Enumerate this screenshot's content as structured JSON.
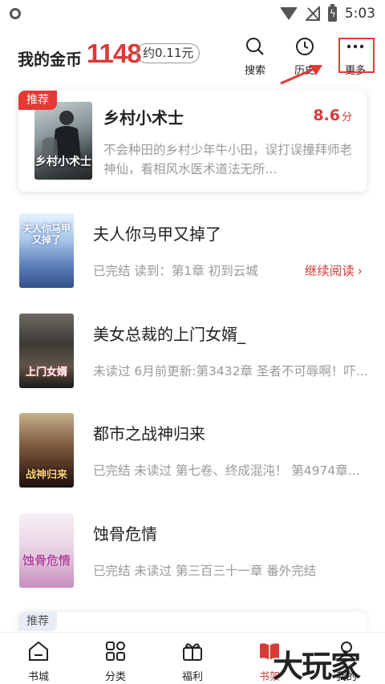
{
  "status_bar": {
    "time": "5:03"
  },
  "header": {
    "coin_label": "我的金币",
    "coin_value": "1148",
    "coin_approx": "约0.11元",
    "search_label": "搜索",
    "history_label": "历史",
    "more_label": "更多"
  },
  "recommend": {
    "tag": "推荐",
    "title": "乡村小术士",
    "score": "8.6",
    "score_unit": "分",
    "description": "不会种田的乡村少年牛小田，误打误撞拜师老神仙，看相风水医术道法无所...",
    "cover_text": "乡村小术士"
  },
  "books": [
    {
      "title": "夫人你马甲又掉了",
      "meta": "已完结 读到：第1章 初到云城",
      "action": "继续阅读",
      "cover_text": "夫人你马甲又掉了"
    },
    {
      "title": "美女总裁的上门女婿_",
      "meta": "未读过 6月前更新:第3432章 圣者不可辱啊！吓...",
      "cover_text": "上门女婿"
    },
    {
      "title": "都市之战神归来",
      "meta": "已完结 未读过 第七卷、终成混沌！ 第4974章...",
      "cover_text": "战神归来"
    },
    {
      "title": "蚀骨危情",
      "meta": "已完结 未读过 第三百三十一章  番外完结",
      "cover_text": "蚀骨危情"
    }
  ],
  "recommend2": {
    "tag": "推荐"
  },
  "bottom_nav": [
    {
      "label": "书城",
      "icon": "home-icon"
    },
    {
      "label": "分类",
      "icon": "grid-icon"
    },
    {
      "label": "福利",
      "icon": "gift-icon"
    },
    {
      "label": "书架",
      "icon": "bookshelf-icon"
    },
    {
      "label": "我的",
      "icon": "profile-icon"
    }
  ],
  "watermark": "大玩家",
  "colors": {
    "accent": "#d83a37",
    "annotation": "#e53935"
  }
}
